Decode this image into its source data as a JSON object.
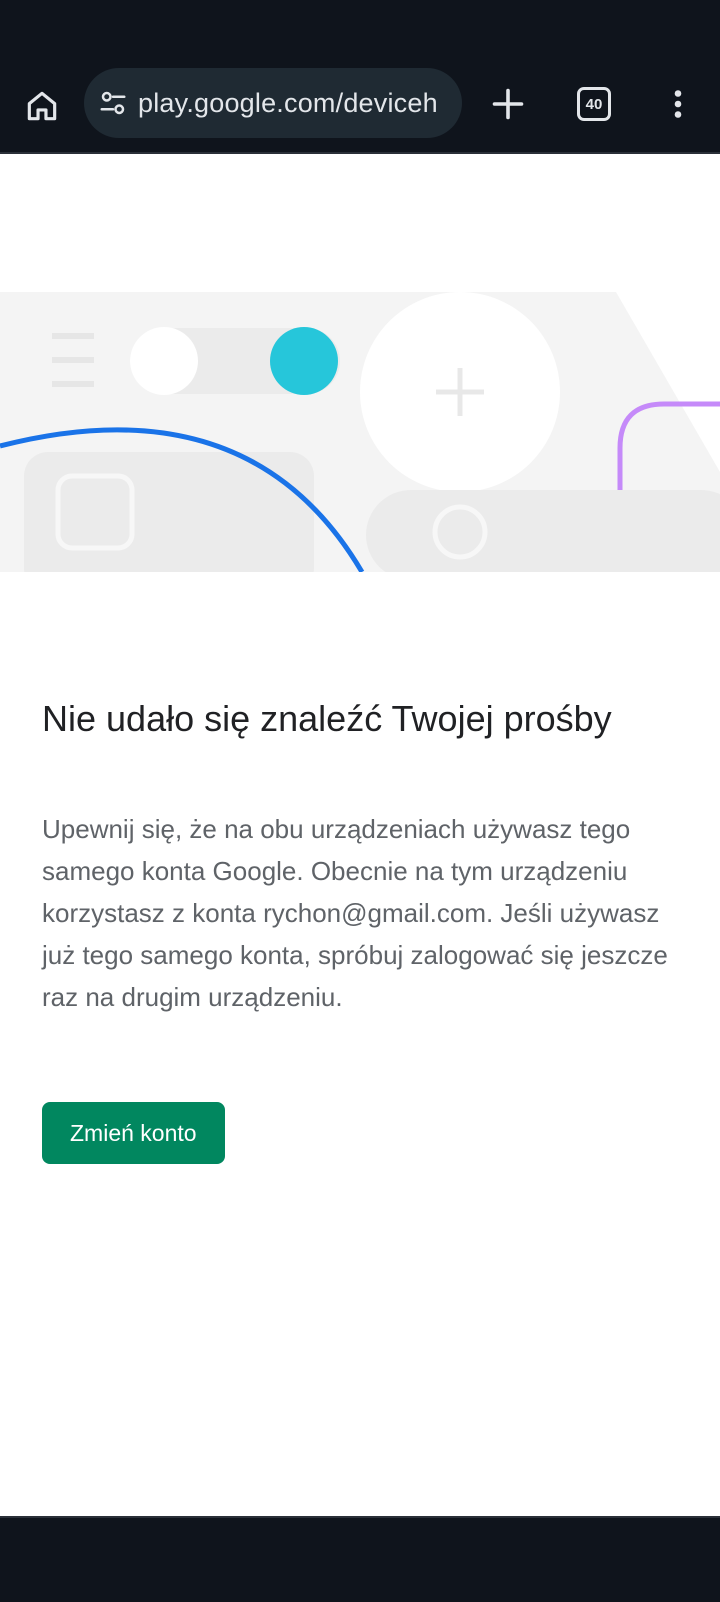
{
  "browser": {
    "url": "play.google.com/deviceh",
    "tab_count": "40",
    "icons": {
      "home": "home-icon",
      "site_settings": "tune-icon",
      "new_tab": "plus-icon",
      "tabs": "tab-switcher-icon",
      "menu": "more-vert-icon"
    }
  },
  "page": {
    "title": "Nie udało się znaleźć Twojej prośby",
    "message": "Upewnij się, że na obu urządzeniach używasz tego samego konta Google. Obecnie na tym urządzeniu korzystasz z konta rychon@gmail.com. Jeśli używasz już tego samego konta, spróbuj zalogować się jeszcze raz na drugim urządzeniu.",
    "button_label": "Zmień konto"
  },
  "colors": {
    "chrome_background": "#0f141c",
    "url_pill": "#1f2a33",
    "button": "#01875f",
    "accent_teal": "#26c6da",
    "accent_blue": "#1a73e8",
    "accent_purple": "#c58af9"
  }
}
